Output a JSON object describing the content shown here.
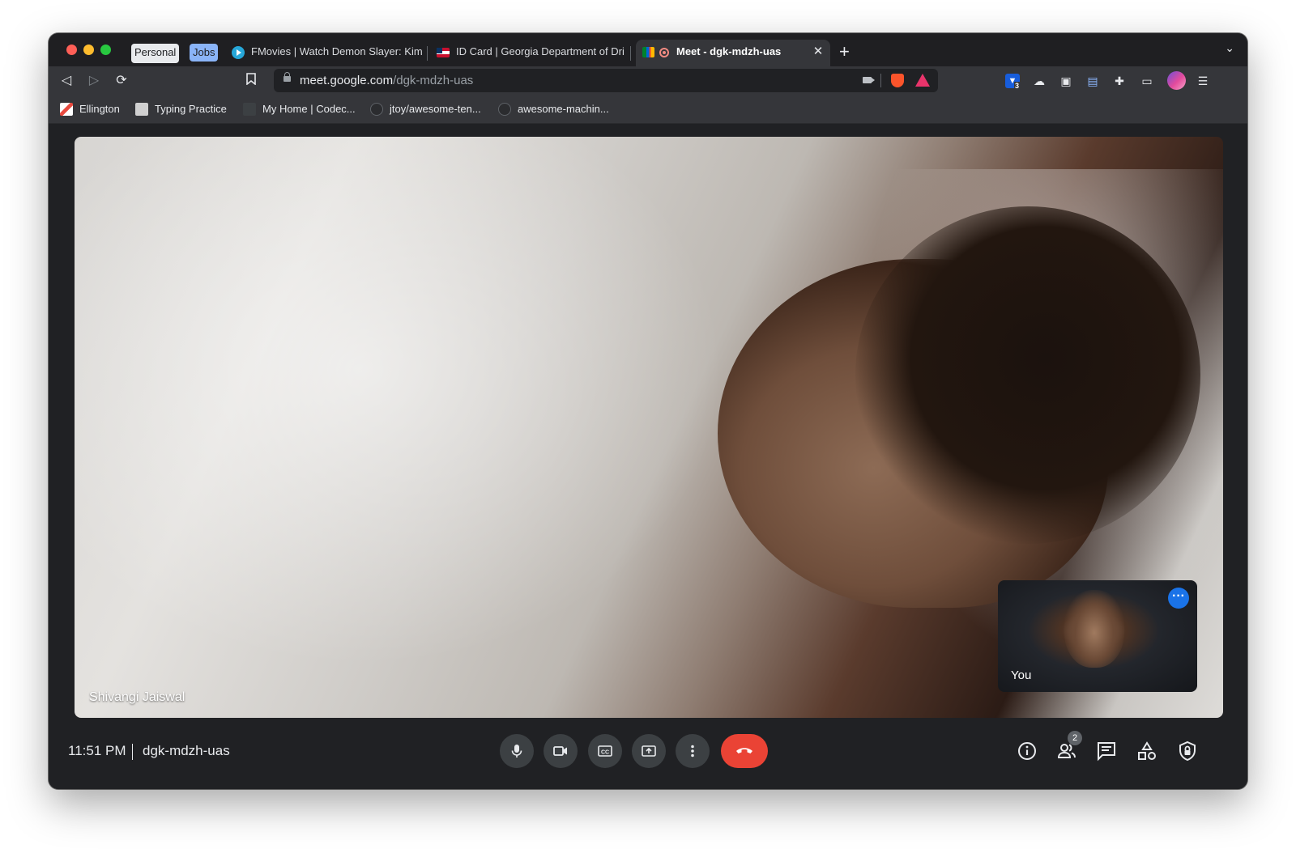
{
  "browser": {
    "tab_groups": [
      {
        "label": "Personal",
        "color": "#e8eaed"
      },
      {
        "label": "Jobs",
        "color": "#8ab4f8"
      }
    ],
    "tabs": [
      {
        "title": "FMovies | Watch Demon Slayer: Kim",
        "icon": "play-icon"
      },
      {
        "title": "ID Card | Georgia Department of Dri",
        "icon": "flag-icon"
      },
      {
        "title": "Meet - dgk-mdzh-uas",
        "icon": "meet-icon",
        "active": true
      }
    ],
    "url_host": "meet.google.com",
    "url_path": "/dgk-mdzh-uas",
    "extension_badge": "3",
    "bookmarks": [
      {
        "label": "Ellington"
      },
      {
        "label": "Typing Practice"
      },
      {
        "label": "My Home | Codec..."
      },
      {
        "label": "jtoy/awesome-ten..."
      },
      {
        "label": "awesome-machin..."
      }
    ]
  },
  "meet": {
    "main_participant": "Shivangi Jaiswal",
    "self_label": "You",
    "time": "11:51 PM",
    "meeting_code": "dgk-mdzh-uas",
    "participant_count": "2",
    "hangup_color": "#ea4335",
    "controls": [
      "microphone-icon",
      "camera-icon",
      "captions-icon",
      "present-icon",
      "more-options-icon",
      "hang-up-icon"
    ],
    "right_controls": [
      "info-icon",
      "people-icon",
      "chat-icon",
      "activities-icon",
      "host-controls-icon"
    ]
  }
}
